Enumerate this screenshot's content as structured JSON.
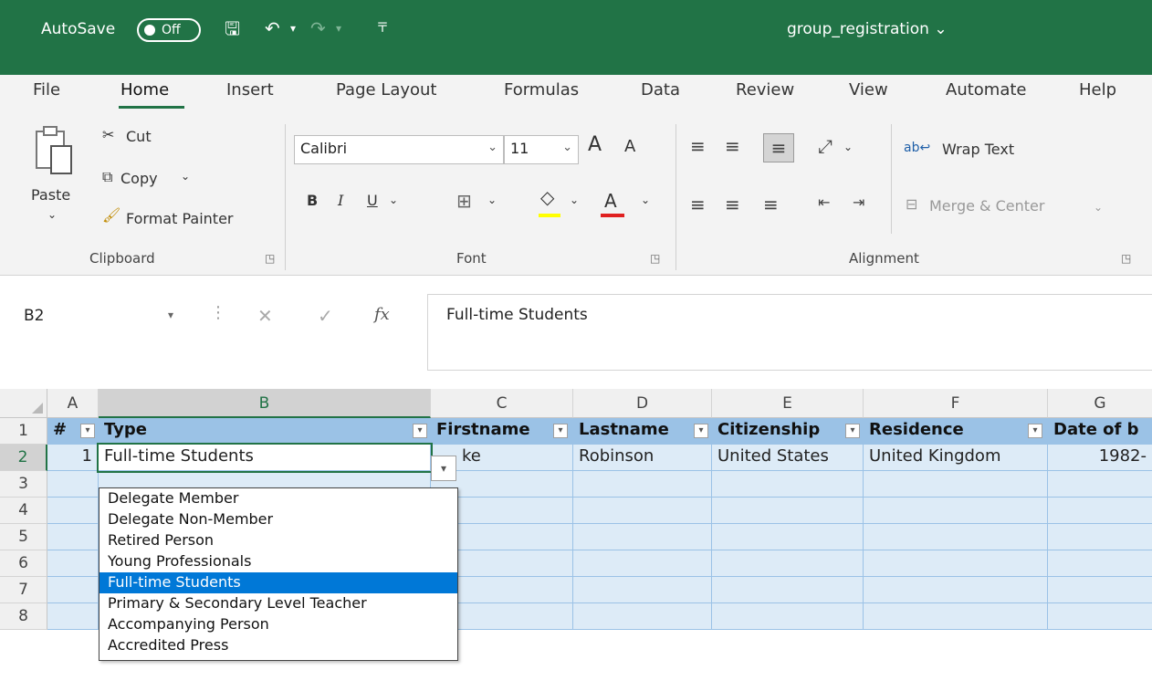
{
  "titlebar": {
    "autosave_label": "AutoSave",
    "autosave_state": "Off",
    "doc_title": "group_registration ⌄"
  },
  "tabs": [
    "File",
    "Home",
    "Insert",
    "Page Layout",
    "Formulas",
    "Data",
    "Review",
    "View",
    "Automate",
    "Help"
  ],
  "ribbon": {
    "clipboard": {
      "paste": "Paste",
      "cut": "Cut",
      "copy": "Copy",
      "format_painter": "Format Painter",
      "group_label": "Clipboard"
    },
    "font": {
      "font_name": "Calibri",
      "font_size": "11",
      "bold": "B",
      "italic": "I",
      "underline": "U",
      "grow": "A",
      "shrink": "A",
      "font_color": "A",
      "group_label": "Font"
    },
    "alignment": {
      "wrap_text": "Wrap Text",
      "merge_center": "Merge & Center",
      "group_label": "Alignment"
    }
  },
  "formula_bar": {
    "name_box": "B2",
    "formula": "Full-time Students"
  },
  "grid": {
    "columns": [
      "A",
      "B",
      "C",
      "D",
      "E",
      "F",
      "G"
    ],
    "rows": [
      "1",
      "2",
      "3",
      "4",
      "5",
      "6",
      "7",
      "8"
    ],
    "headers": [
      "#",
      "Type",
      "Firstname",
      "Lastname",
      "Citizenship",
      "Residence",
      "Date of b"
    ],
    "row2": [
      "1",
      "Full-time Students",
      "ke",
      "Robinson",
      "United States",
      "United Kingdom",
      "1982-"
    ]
  },
  "dropdown": {
    "options": [
      "Delegate Member",
      "Delegate Non-Member",
      "Retired Person",
      "Young Professionals",
      "Full-time Students",
      "Primary & Secondary Level Teacher",
      "Accompanying Person",
      "Accredited Press"
    ],
    "selected_index": 4
  },
  "colors": {
    "title_green": "#217346",
    "table_header": "#9bc2e6",
    "table_band": "#ddebf7",
    "selection_blue": "#0078d7"
  }
}
